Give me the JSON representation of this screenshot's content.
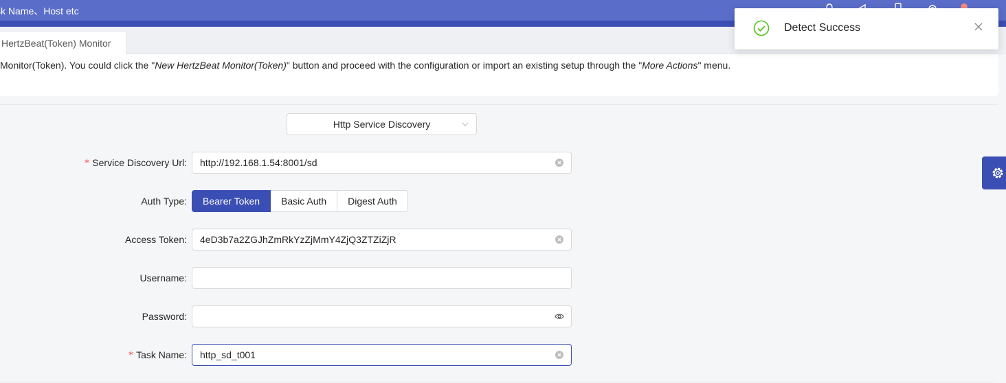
{
  "header": {
    "search_placeholder": "sk Name、Host etc",
    "icons": [
      "bell-icon",
      "megaphone-icon",
      "phone-icon",
      "gear-icon",
      "user-avatar"
    ],
    "colors": {
      "bar": "#5a6dc9",
      "strip": "#3b4eb3"
    }
  },
  "tabs": [
    {
      "label": "HertzBeat(Token) Monitor"
    }
  ],
  "info": {
    "part1": "Monitor(Token). You could click the \"",
    "em1": "New HertzBeat Monitor(Token)",
    "part2": "\" button and proceed with the configuration or import an existing setup through the \"",
    "em2": "More Actions",
    "part3": "\" menu."
  },
  "discovery_select": {
    "value": "Http Service Discovery"
  },
  "form": {
    "service_url": {
      "label": "Service Discovery Url",
      "value": "http://192.168.1.54:8001/sd",
      "required": true
    },
    "auth_type": {
      "label": "Auth Type",
      "options": [
        "Bearer Token",
        "Basic Auth",
        "Digest Auth"
      ],
      "selected": "Bearer Token"
    },
    "access_token": {
      "label": "Access Token",
      "value": "4eD3b7a2ZGJhZmRkYzZjMmY4ZjQ3ZTZiZjR"
    },
    "username": {
      "label": "Username",
      "value": ""
    },
    "password": {
      "label": "Password",
      "value": ""
    },
    "task_name": {
      "label": "Task Name",
      "value": "http_sd_t001",
      "required": true
    },
    "colon": ":"
  },
  "notification": {
    "message": "Detect Success",
    "status_color": "#52c41a"
  },
  "accent_color": "#3b4eb3"
}
